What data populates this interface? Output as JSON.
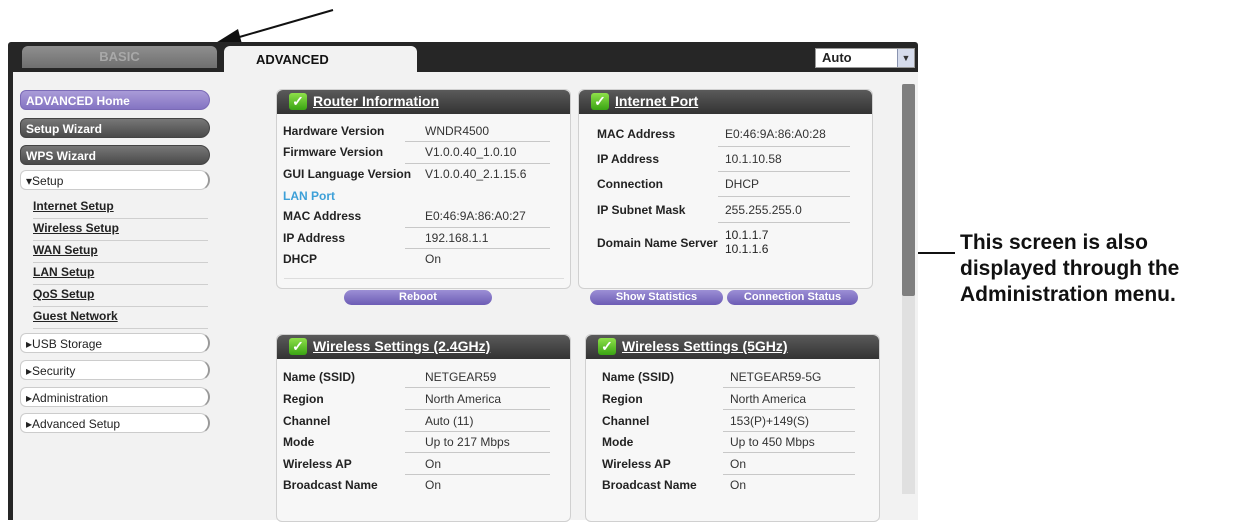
{
  "tabs": {
    "basic": "BASIC",
    "advanced": "ADVANCED"
  },
  "language_select": {
    "value": "Auto"
  },
  "menu": {
    "home": "ADVANCED Home",
    "setup_wizard": "Setup Wizard",
    "wps_wizard": "WPS Wizard",
    "setup": "▾Setup",
    "setup_items": [
      "Internet Setup",
      "Wireless Setup",
      "WAN Setup",
      "LAN Setup",
      "QoS Setup",
      "Guest Network"
    ],
    "usb": "▸USB Storage",
    "security": "▸Security",
    "administration": "▸Administration",
    "advanced_setup": "▸Advanced Setup"
  },
  "router_info": {
    "title": "Router Information",
    "rows": [
      {
        "k": "Hardware Version",
        "v": "WNDR4500"
      },
      {
        "k": "Firmware Version",
        "v": "V1.0.0.40_1.0.10"
      },
      {
        "k": "GUI Language Version",
        "v": "V1.0.0.40_2.1.15.6"
      }
    ],
    "lan_port": "LAN Port",
    "lan_rows": [
      {
        "k": "MAC Address",
        "v": "E0:46:9A:86:A0:27"
      },
      {
        "k": "IP Address",
        "v": "192.168.1.1"
      },
      {
        "k": "DHCP",
        "v": "On"
      }
    ],
    "reboot": "Reboot"
  },
  "internet_port": {
    "title": "Internet Port",
    "rows": [
      {
        "k": "MAC Address",
        "v": "E0:46:9A:86:A0:28"
      },
      {
        "k": "IP Address",
        "v": "10.1.10.58"
      },
      {
        "k": "Connection",
        "v": "DHCP"
      },
      {
        "k": "IP Subnet Mask",
        "v": "255.255.255.0"
      },
      {
        "k": "Domain Name Server",
        "v": "10.1.1.7",
        "v2": "10.1.1.6"
      }
    ],
    "show_statistics": "Show Statistics",
    "connection_status": "Connection Status"
  },
  "wireless_24": {
    "title": "Wireless Settings (2.4GHz)",
    "rows": [
      {
        "k": "Name (SSID)",
        "v": "NETGEAR59"
      },
      {
        "k": "Region",
        "v": "North America"
      },
      {
        "k": "Channel",
        "v": "Auto (11)"
      },
      {
        "k": "Mode",
        "v": "Up to 217 Mbps"
      },
      {
        "k": "Wireless AP",
        "v": "On"
      },
      {
        "k": "Broadcast Name",
        "v": "On"
      }
    ]
  },
  "wireless_5": {
    "title": "Wireless Settings (5GHz)",
    "rows": [
      {
        "k": "Name (SSID)",
        "v": "NETGEAR59-5G"
      },
      {
        "k": "Region",
        "v": "North America"
      },
      {
        "k": "Channel",
        "v": "153(P)+149(S)"
      },
      {
        "k": "Mode",
        "v": "Up to 450 Mbps"
      },
      {
        "k": "Wireless AP",
        "v": "On"
      },
      {
        "k": "Broadcast Name",
        "v": "On"
      }
    ]
  },
  "callout": {
    "text": "This screen is also displayed through the Administration menu."
  }
}
